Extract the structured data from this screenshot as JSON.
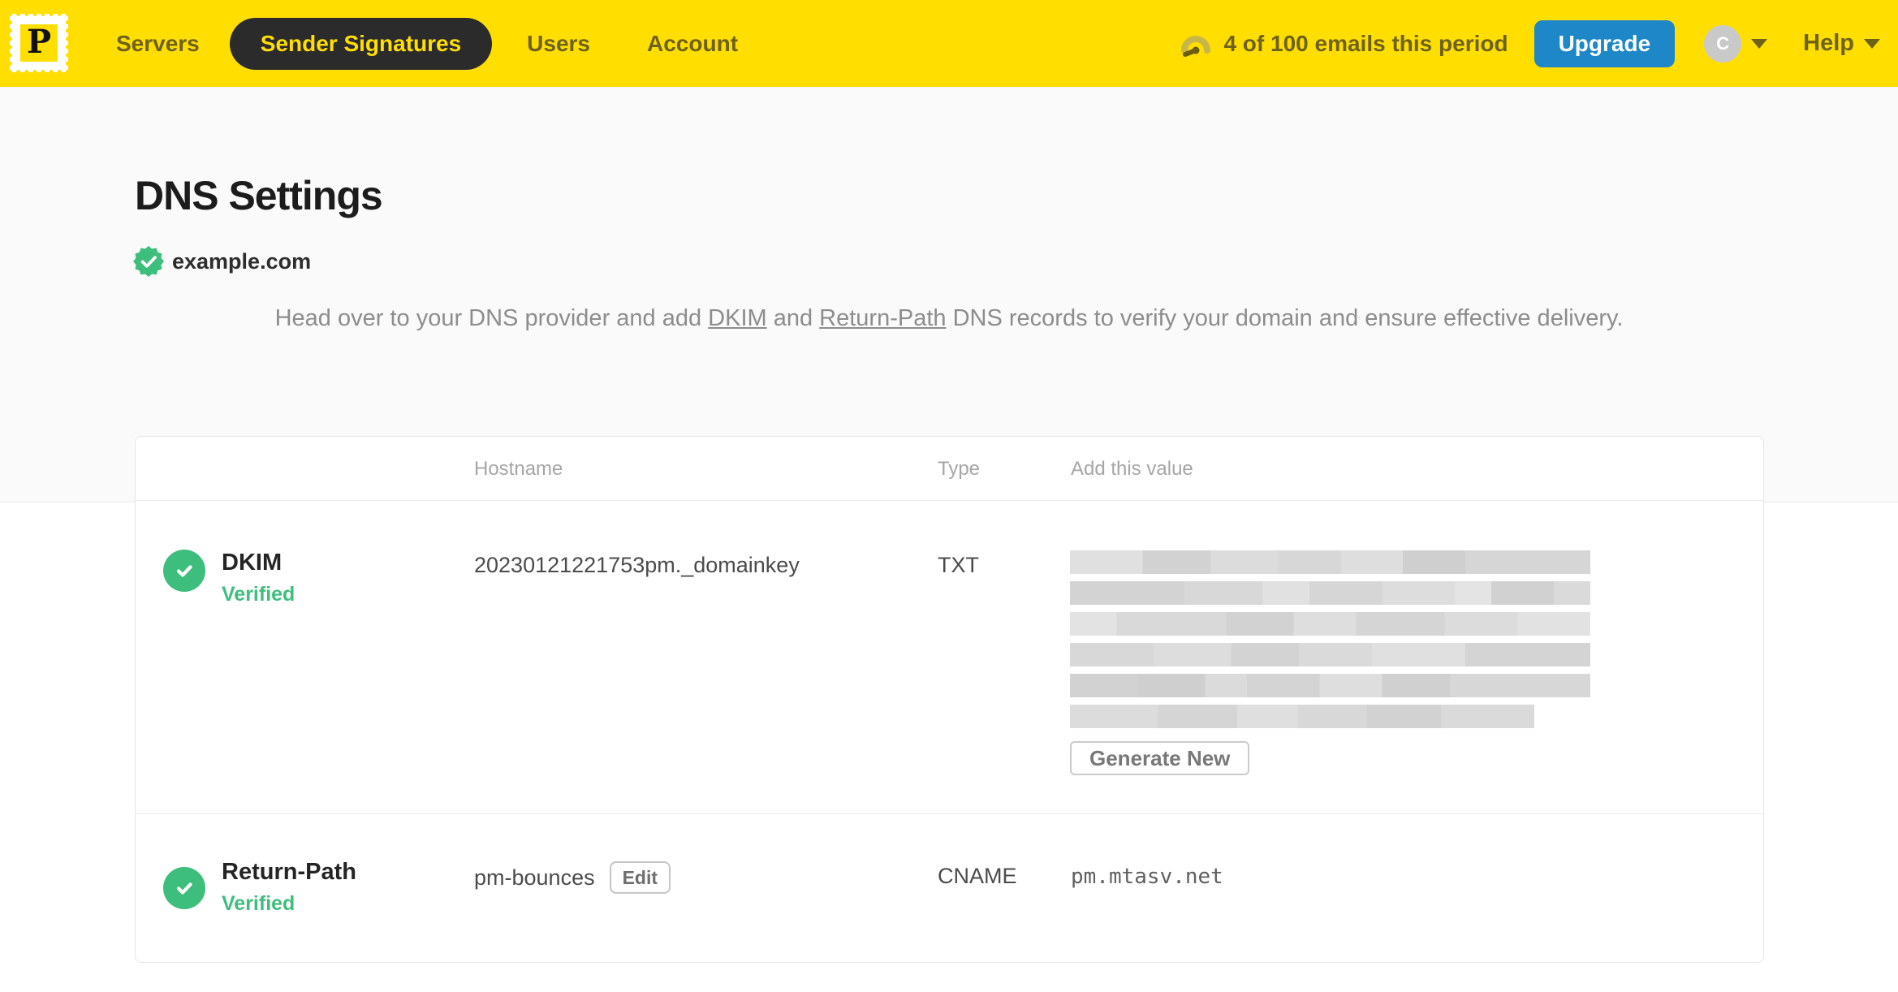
{
  "colors": {
    "brand_yellow": "#FFDE00",
    "pill_dark": "#2B2B2B",
    "nav_text": "#6E6118",
    "accent_blue": "#1D87C8",
    "success_green": "#3EBE7C"
  },
  "nav": {
    "logo_letter": "P",
    "items": [
      {
        "label": "Servers",
        "active": false
      },
      {
        "label": "Sender Signatures",
        "active": true
      },
      {
        "label": "Users",
        "active": false
      },
      {
        "label": "Account",
        "active": false
      }
    ],
    "usage_text": "4 of 100 emails this period",
    "upgrade_label": "Upgrade",
    "avatar_initial": "C",
    "help_label": "Help"
  },
  "page": {
    "title": "DNS Settings",
    "domain": "example.com",
    "description": {
      "part1": "Head over to your DNS provider and add ",
      "link1": "DKIM",
      "part2": " and ",
      "link2": "Return-Path",
      "part3": " DNS records to verify your domain and ensure effective delivery."
    }
  },
  "table": {
    "headers": {
      "hostname": "Hostname",
      "type": "Type",
      "value": "Add this value"
    },
    "rows": [
      {
        "name": "DKIM",
        "status": "Verified",
        "hostname": "20230121221753pm._domainkey",
        "type": "TXT",
        "value_redacted": true,
        "value_redacted_lines": 6,
        "action_label": "Generate New"
      },
      {
        "name": "Return-Path",
        "status": "Verified",
        "hostname": "pm-bounces",
        "edit_label": "Edit",
        "type": "CNAME",
        "value": "pm.mtasv.net"
      }
    ]
  }
}
